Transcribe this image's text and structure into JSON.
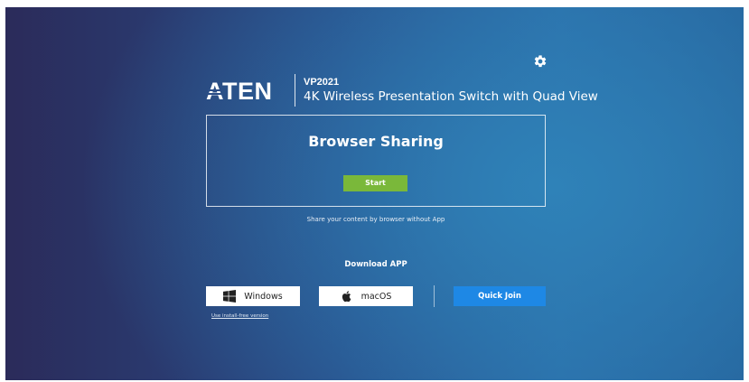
{
  "brand": {
    "logo_text": "ATEN",
    "model": "VP2021",
    "product_name": "4K Wireless Presentation Switch with Quad View"
  },
  "settings": {
    "icon": "gear-icon"
  },
  "browser_sharing": {
    "title": "Browser Sharing",
    "start_label": "Start",
    "caption": "Share your content by browser without App"
  },
  "download": {
    "label": "Download APP",
    "windows_label": "Windows",
    "windows_icon": "windows-icon",
    "macos_label": "macOS",
    "macos_icon": "apple-icon",
    "install_free_link": "Use install-free version"
  },
  "quick_join": {
    "label": "Quick Join"
  },
  "colors": {
    "accent_green": "#7ab83a",
    "accent_blue": "#1e88e5",
    "background_dark": "#2b2b5a",
    "background_light": "#2f82b8"
  }
}
